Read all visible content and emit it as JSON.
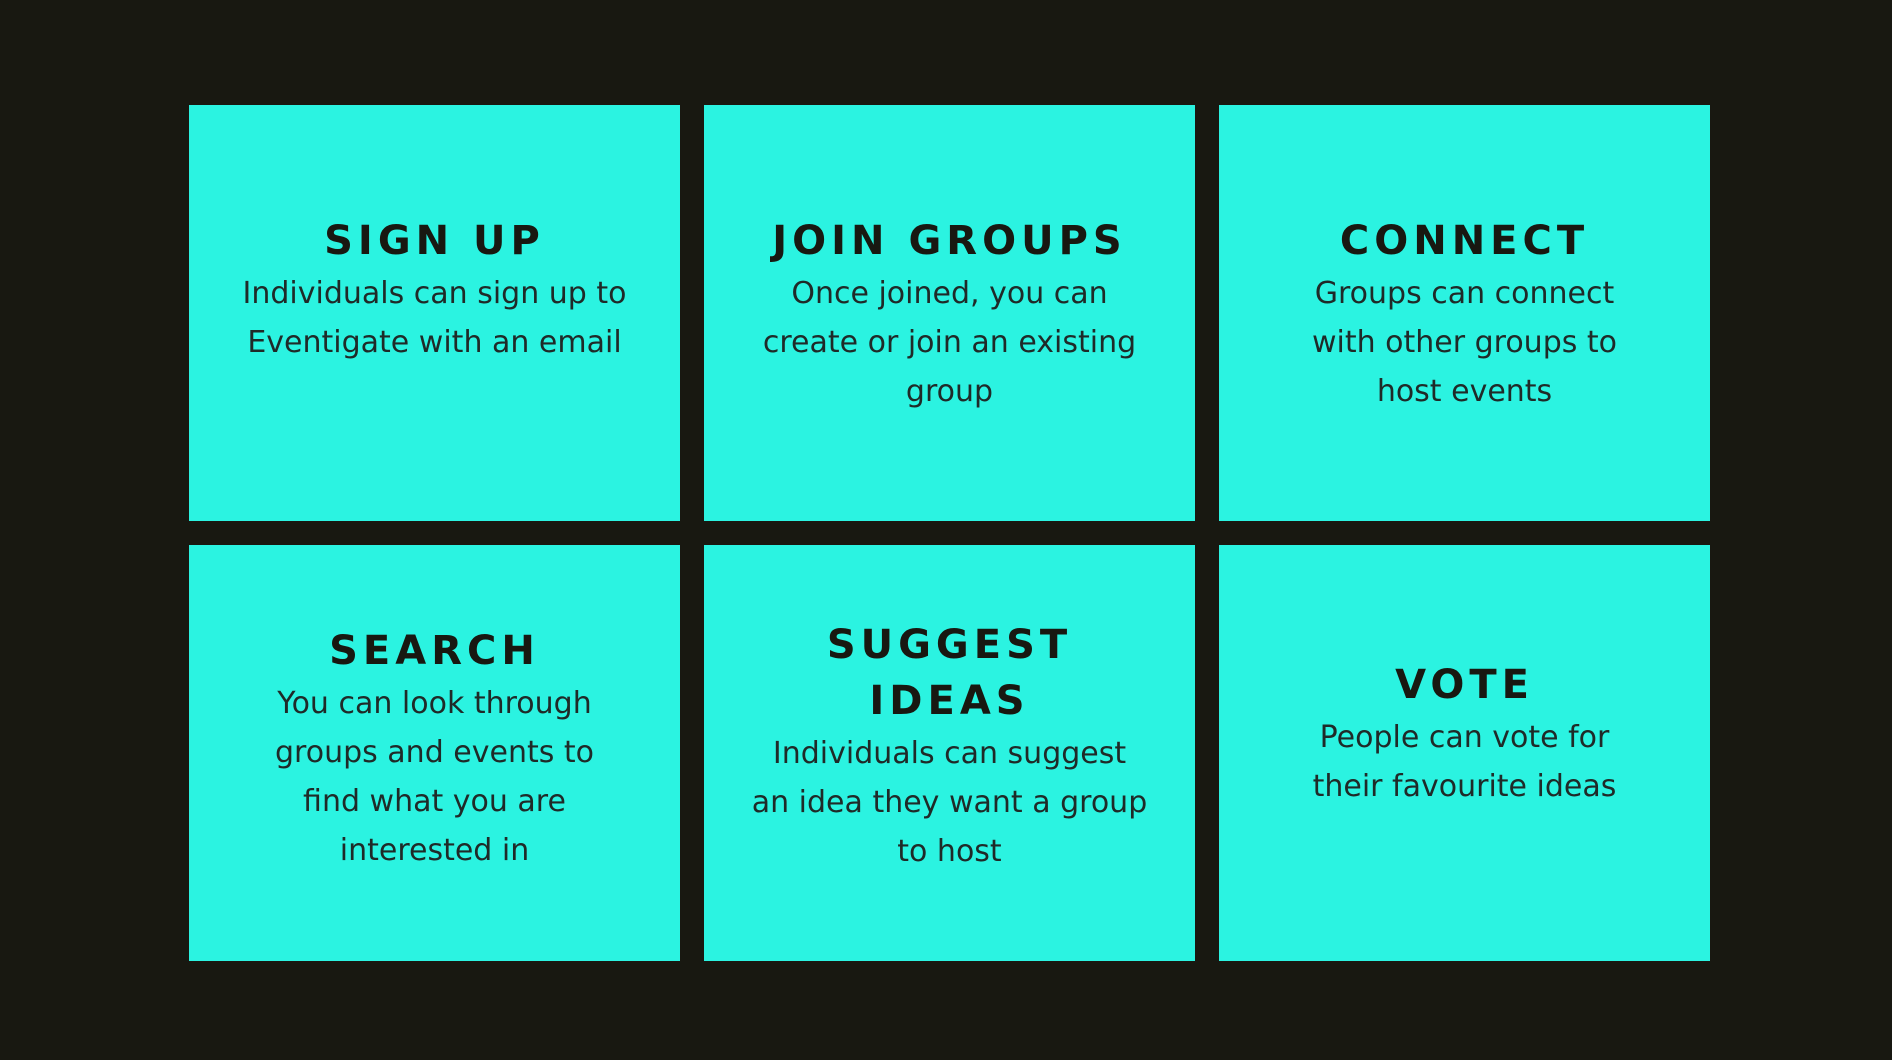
{
  "cards": [
    {
      "title": "SIGN UP",
      "description": "Individuals can sign up to Eventigate with an email"
    },
    {
      "title": "JOIN GROUPS",
      "description": "Once joined, you can create or join an existing group"
    },
    {
      "title": "CONNECT",
      "description": "Groups can connect with other groups to host events"
    },
    {
      "title": "SEARCH",
      "description": "You can look through groups and events to find what you are interested in"
    },
    {
      "title": "SUGGEST IDEAS",
      "description": "Individuals can suggest an idea they want a group to host"
    },
    {
      "title": "VOTE",
      "description": "People can vote for their favourite ideas"
    }
  ],
  "colors": {
    "background": "#181811",
    "card": "#2bf3e1",
    "text": "#181811"
  }
}
